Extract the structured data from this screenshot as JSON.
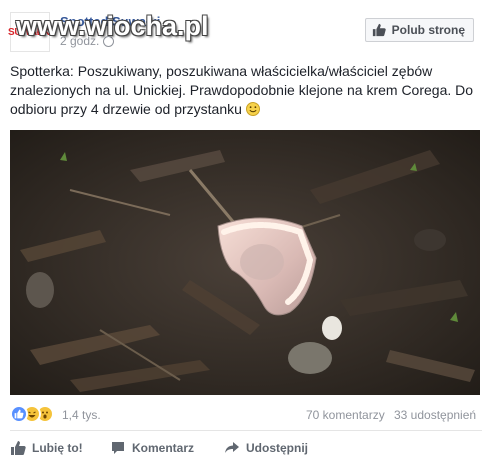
{
  "header": {
    "avatar_text": "SUWAŁKI",
    "page_name": "Spotted Suwałki",
    "timestamp": "2 godz.",
    "like_page_label": "Polub stronę"
  },
  "watermark": {
    "text": "www.wiocha.pl"
  },
  "post": {
    "text": "Spotterka: Poszukiwany, poszukiwana właścicielka/właściciel zębów znalezionych na ul. Unickiej. Prawdopodobnie klejone na krem Corega. Do odbioru przy 4 drzewie od przystanku",
    "emoji": "smiley-icon"
  },
  "photo": {
    "subject": "photo-dentures-on-soil"
  },
  "stats": {
    "reaction_icons": [
      "like-reaction-icon",
      "haha-reaction-icon",
      "wow-reaction-icon"
    ],
    "reactions": "1,4 tys.",
    "comments": "70 komentarzy",
    "shares": "33 udostępnień"
  },
  "actions": {
    "like": "Lubię to!",
    "comment": "Komentarz",
    "share": "Udostępnij"
  },
  "colors": {
    "link": "#365899",
    "muted": "#90949c",
    "action_text": "#606770",
    "like_blue": "#5890ff",
    "watermark": "#ffffff"
  }
}
